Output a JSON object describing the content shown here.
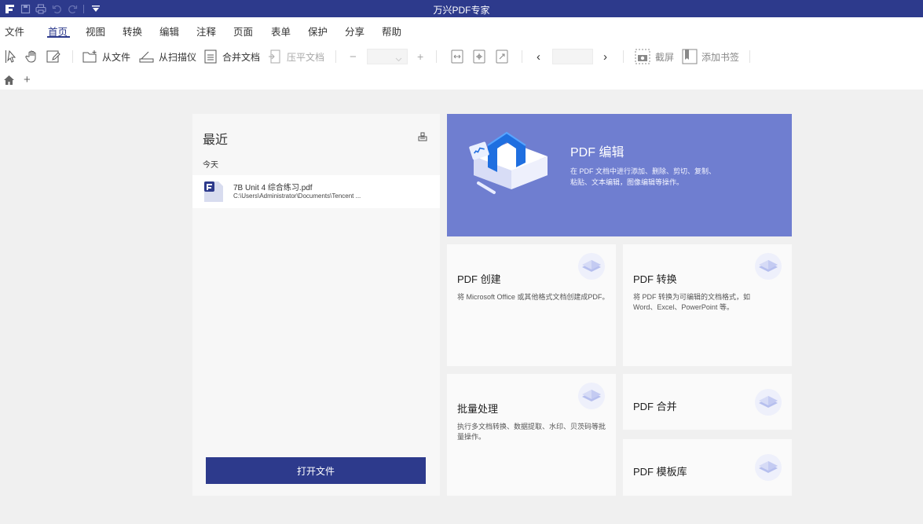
{
  "app": {
    "title": "万兴PDF专家"
  },
  "menu": {
    "file": "文件",
    "tabs": [
      "首页",
      "视图",
      "转换",
      "编辑",
      "注释",
      "页面",
      "表单",
      "保护",
      "分享",
      "帮助"
    ]
  },
  "toolbar": {
    "from_file": "从文件",
    "from_scanner": "从扫描仪",
    "merge_docs": "合并文档",
    "compress_doc": "压平文档",
    "zoom_out": "−",
    "zoom_in": "+",
    "prev_page": "‹",
    "next_page": "›",
    "screenshot": "截屏",
    "add_bookmark": "添加书签"
  },
  "tabrow": {
    "new_tab": "+"
  },
  "recent": {
    "heading": "最近",
    "group_label": "今天",
    "files": [
      {
        "name": "7B Unit 4 综合练习.pdf",
        "path": "C:\\Users\\Administrator\\Documents\\Tencent ..."
      }
    ],
    "open_button": "打开文件"
  },
  "features": {
    "edit": {
      "title": "PDF 编辑",
      "desc": "在 PDF 文档中进行添加、删除、剪切、复制、粘贴、文本编辑，图像编辑等操作。"
    },
    "create": {
      "title": "PDF 创建",
      "desc": "将 Microsoft Office 或其他格式文档创建成PDF。"
    },
    "convert": {
      "title": "PDF 转换",
      "desc": "将 PDF 转换为可编辑的文档格式，如 Word、Excel、PowerPoint 等。"
    },
    "batch": {
      "title": "批量处理",
      "desc": "执行多文档转换、数据提取、水印、贝茨码等批量操作。"
    },
    "merge": {
      "title": "PDF 合并"
    },
    "templates": {
      "title": "PDF 模板库"
    }
  },
  "colors": {
    "brand": "#2d3a8c",
    "hero": "#6f7ed0"
  }
}
